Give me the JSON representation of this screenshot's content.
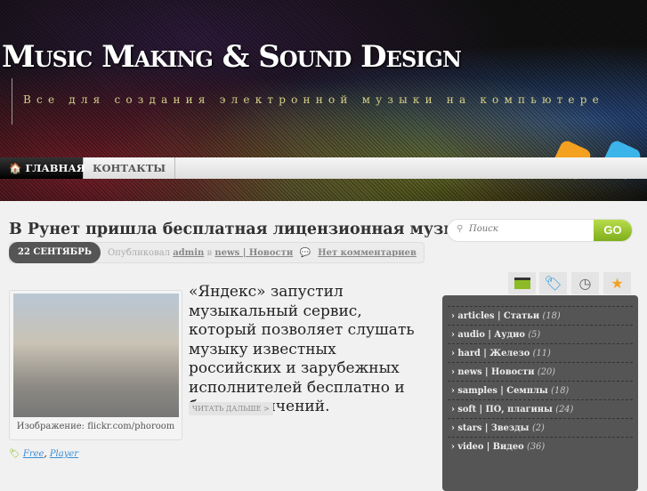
{
  "header": {
    "title": "Music Making & Sound Design",
    "tagline": "Все для создания электронной музыки на компьютере"
  },
  "nav": {
    "items": [
      {
        "label": "ГЛАВНАЯ",
        "icon": "home-icon"
      },
      {
        "label": "КОНТАКТЫ"
      }
    ]
  },
  "post": {
    "title": "В Рунет пришла бесплатная лицензионная музыка",
    "date": "22 СЕНТЯБРЬ",
    "posted_by": "Опубликовал",
    "author": "admin",
    "in": "в",
    "category": "news | Новости",
    "comments": "Нет комментариев",
    "caption": "Изображение: flickr.com/phoroom",
    "excerpt": "«Яндекс» запустил музыкальный сервис, который позволяет слушать музыку известных российских и зарубежных исполнителей бесплатно и без ограничений.",
    "read_more": "ЧИТАТЬ ДАЛЬШЕ >",
    "tags": [
      "Free",
      "Player"
    ]
  },
  "sidebar": {
    "search_placeholder": "Поиск",
    "go": "GO",
    "tabs": [
      "folder-icon",
      "tag-icon",
      "clock-icon",
      "star-icon"
    ],
    "categories": [
      {
        "name": "articles | Статьи",
        "count": "(18)"
      },
      {
        "name": "audio | Аудио",
        "count": "(5)"
      },
      {
        "name": "hard | Железо",
        "count": "(11)"
      },
      {
        "name": "news | Новости",
        "count": "(20)"
      },
      {
        "name": "samples | Семплы",
        "count": "(18)"
      },
      {
        "name": "soft | ПО, плагины",
        "count": "(24)"
      },
      {
        "name": "stars | Звезды",
        "count": "(2)"
      },
      {
        "name": "video | Видео",
        "count": "(36)"
      }
    ]
  },
  "colors": {
    "accent": "#8dbb26",
    "dark": "#555555",
    "link": "#3a8fd6"
  }
}
